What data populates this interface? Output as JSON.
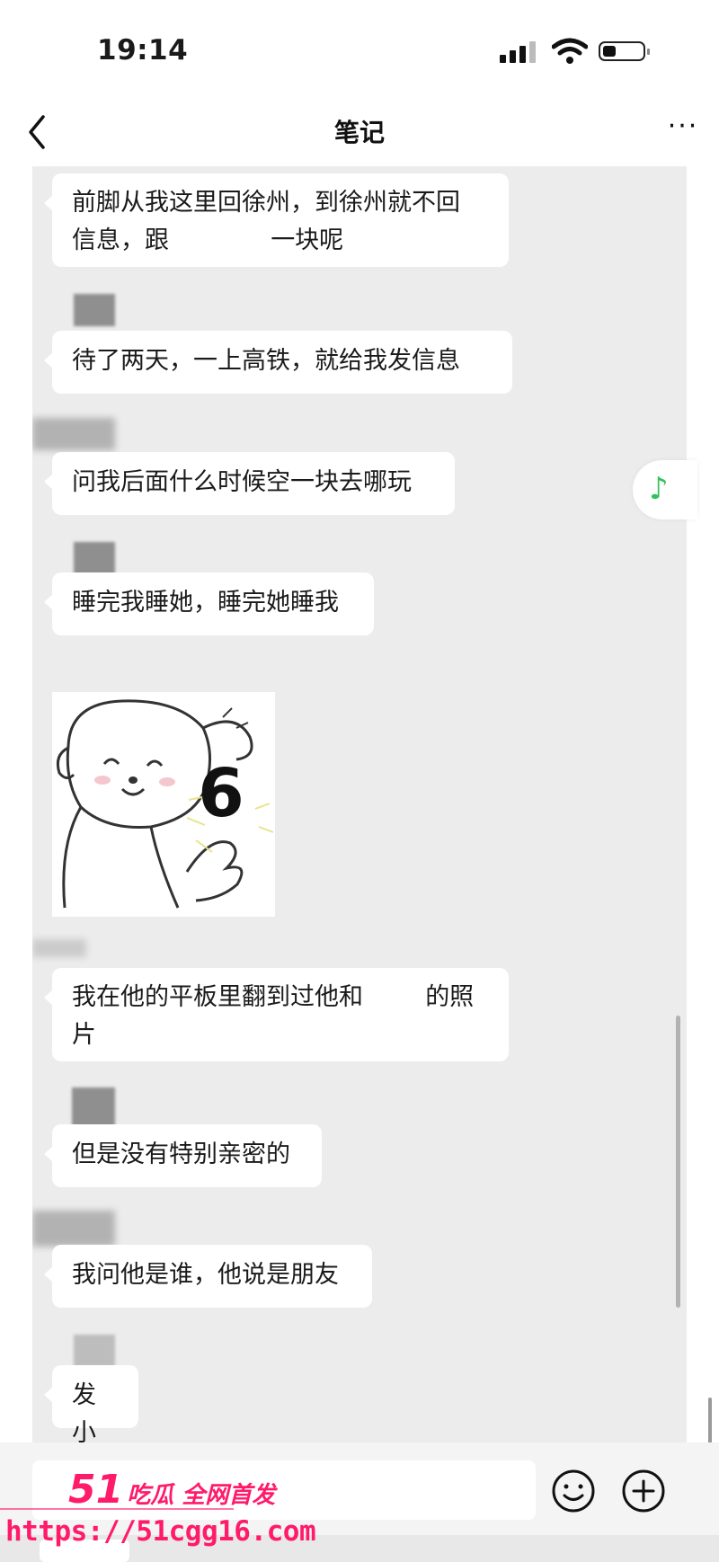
{
  "status_bar": {
    "time": "19:14"
  },
  "nav": {
    "title": "笔记",
    "more_label": "···"
  },
  "messages": [
    {
      "line1": "前脚从我这里回徐州，到徐州就不回",
      "line2a": "信息，跟",
      "line2b": "一块呢"
    },
    {
      "text": "待了两天，一上高铁，就给我发信息"
    },
    {
      "text": "问我后面什么时候空一块去哪玩"
    },
    {
      "text": "睡完我睡她，睡完她睡我"
    },
    {
      "sticker_text": "6"
    },
    {
      "line1a": "我在他的平板里翻到过他和",
      "line1b": "的照",
      "line2": "片"
    },
    {
      "text": "但是没有特别亲密的"
    },
    {
      "text": "我问他是谁，他说是朋友"
    },
    {
      "text": "发小"
    }
  ],
  "music_fab": {
    "glyph": "♪",
    "color": "#33c25a"
  },
  "watermark": {
    "num": "51",
    "cn": "吃瓜 全网首发",
    "url": "https://51cgg16.com",
    "color": "#ff1a6a"
  }
}
